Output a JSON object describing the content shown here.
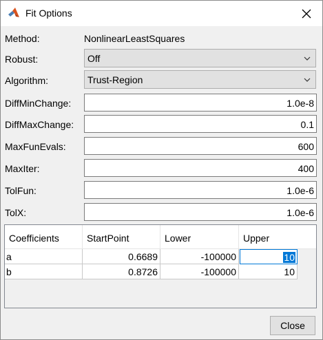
{
  "window": {
    "title": "Fit Options",
    "app_icon": "matlab-icon",
    "close_icon": "close-icon"
  },
  "method": {
    "label": "Method:",
    "value": "NonlinearLeastSquares"
  },
  "robust": {
    "label": "Robust:",
    "value": "Off"
  },
  "algorithm": {
    "label": "Algorithm:",
    "value": "Trust-Region"
  },
  "fields": [
    {
      "label": "DiffMinChange:",
      "value": "1.0e-8"
    },
    {
      "label": "DiffMaxChange:",
      "value": "0.1"
    },
    {
      "label": "MaxFunEvals:",
      "value": "600"
    },
    {
      "label": "MaxIter:",
      "value": "400"
    },
    {
      "label": "TolFun:",
      "value": "1.0e-6"
    },
    {
      "label": "TolX:",
      "value": "1.0e-6"
    }
  ],
  "table": {
    "headers": [
      "Coefficients",
      "StartPoint",
      "Lower",
      "Upper"
    ],
    "rows": [
      [
        "a",
        "0.6689",
        "-100000",
        "10"
      ],
      [
        "b",
        "0.8726",
        "-100000",
        "10"
      ]
    ]
  },
  "buttons": {
    "close_label": "Close"
  },
  "colors": {
    "selection": "#0078d7",
    "window_bg": "#f0f0f0"
  }
}
